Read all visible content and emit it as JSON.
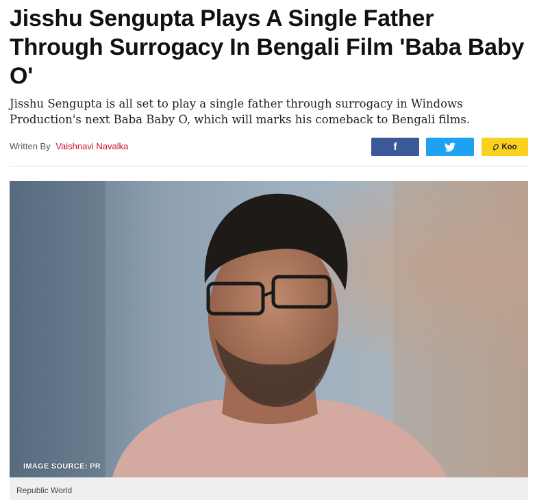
{
  "article": {
    "headline": "Jisshu Sengupta Plays A Single Father Through Surrogacy In Bengali Film 'Baba Baby O'",
    "summary": "Jisshu Sengupta is all set to play a single father through surrogacy in Windows Production's next Baba Baby O, which will marks his comeback to Bengali films.",
    "byline_prefix": "Written By",
    "author": "Vaishnavi Navalka"
  },
  "share": {
    "facebook_icon": "f",
    "twitter_icon": "twitter-bird",
    "koo_label": "Koo",
    "colors": {
      "facebook": "#3b5998",
      "twitter": "#1da1f2",
      "koo": "#fad11f"
    }
  },
  "image": {
    "source_caption": "IMAGE SOURCE: PR",
    "credit": "Republic World"
  },
  "colors": {
    "author_link": "#c8102e"
  }
}
